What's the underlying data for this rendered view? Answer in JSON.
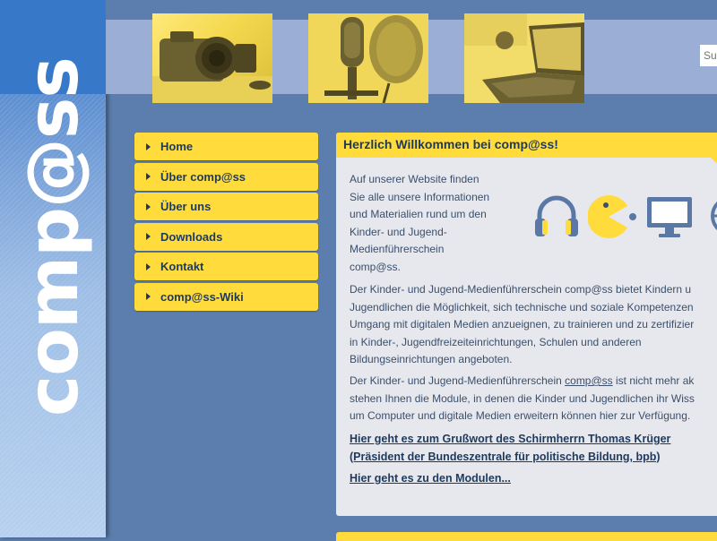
{
  "brand": {
    "logo_text": "comp@ss"
  },
  "header": {
    "search_placeholder": "Su",
    "photos": [
      "camera-photo",
      "microphone-photo",
      "laptop-photo"
    ]
  },
  "nav": {
    "items": [
      {
        "label": "Home"
      },
      {
        "label": "Über comp@ss"
      },
      {
        "label": "Über uns"
      },
      {
        "label": "Downloads"
      },
      {
        "label": "Kontakt"
      },
      {
        "label": "comp@ss-Wiki"
      }
    ]
  },
  "main": {
    "title": "Herzlich Willkommen bei comp@ss!",
    "intro_lines": [
      "Auf unserer Website finden",
      "Sie alle unsere Informationen",
      "und Materialien rund um den",
      "Kinder- und Jugend-",
      "Medienführerschein",
      "comp@ss."
    ],
    "paragraph1_lines": [
      "Der Kinder- und Jugend-Medienführerschein comp@ss bietet Kindern u",
      "Jugendlichen die Möglichkeit, sich technische und soziale Kompetenzen",
      "Umgang mit digitalen Medien anzueignen, zu trainieren und zu zertifizier",
      "in Kinder-, Jugendfreizeiteinrichtungen, Schulen und anderen",
      "Bildungseinrichtungen angeboten."
    ],
    "paragraph2": {
      "line1_before": "Der Kinder- und Jugend-Medienführerschein ",
      "line1_link": "comp@ss",
      "line1_after": " ist nicht mehr ak",
      "line2": "stehen Ihnen die Module, in denen die Kinder und Jugendlichen ihr Wiss",
      "line3": "um Computer und digitale Medien erweitern können hier zur Verfügung."
    },
    "link_grusswort_line1": "Hier geht es zum Grußwort des Schirmherrn Thomas Krüger",
    "link_grusswort_line2": "(Präsident der Bundeszentrale für politische Bildung, bpb)",
    "link_module": "Hier geht es zu den Modulen... ",
    "icons": [
      "headphones-icon",
      "pacman-icon",
      "monitor-icon",
      "globe-icon"
    ]
  },
  "colors": {
    "background": "#5c7eae",
    "accent_yellow": "#ffdc3c",
    "header_band": "#9aaed6",
    "text_dark_blue": "#1d3a5e",
    "icon_blue": "#5a78a6"
  }
}
